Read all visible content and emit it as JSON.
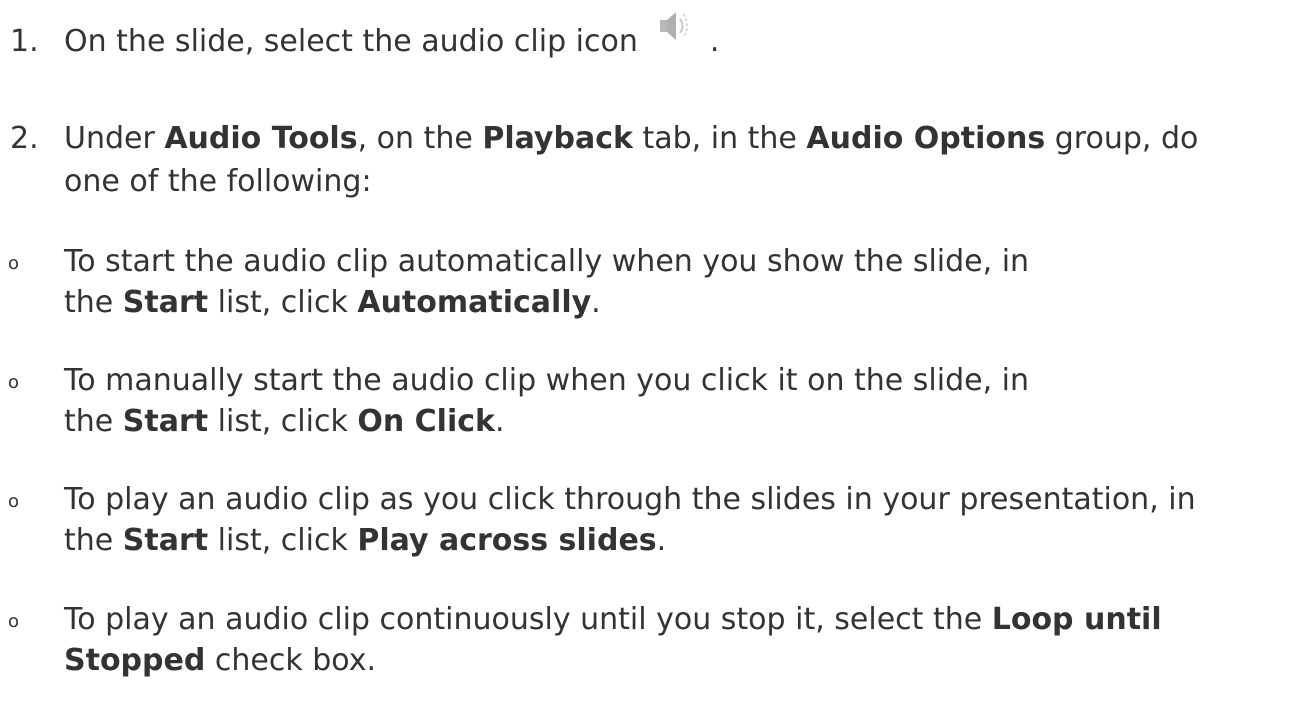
{
  "steps": [
    {
      "num": "1.",
      "t1": "On the slide, select the audio clip icon",
      "icon": "speaker-icon",
      "t2": "."
    },
    {
      "num": "2.",
      "t1": "Under ",
      "b1": "Audio Tools",
      "t2": ", on the ",
      "b2": "Playback",
      "t3": " tab, in the ",
      "b3": "Audio Options",
      "t4": " group, do",
      "t5": "one of the following:"
    }
  ],
  "options": [
    {
      "bullet": "o",
      "line1": "To start the audio clip automatically when you show the slide, in",
      "a": "the ",
      "b1": "Start",
      "c": " list, click ",
      "b2": "Automatically",
      "d": "."
    },
    {
      "bullet": "o",
      "line1": "To manually start the audio clip when you click it on the slide, in",
      "a": "the ",
      "b1": "Start",
      "c": " list, click ",
      "b2": "On Click",
      "d": "."
    },
    {
      "bullet": "o",
      "line1": "To play an audio clip as you click through the slides in your presentation, in",
      "a": "the ",
      "b1": "Start",
      "c": " list, click ",
      "b2": "Play across slides",
      "d": "."
    },
    {
      "bullet": "o",
      "line1a": "To play an audio clip continuously until you stop it, select the ",
      "line1b": "Loop until",
      "b2": "Stopped",
      "d": " check box."
    }
  ]
}
